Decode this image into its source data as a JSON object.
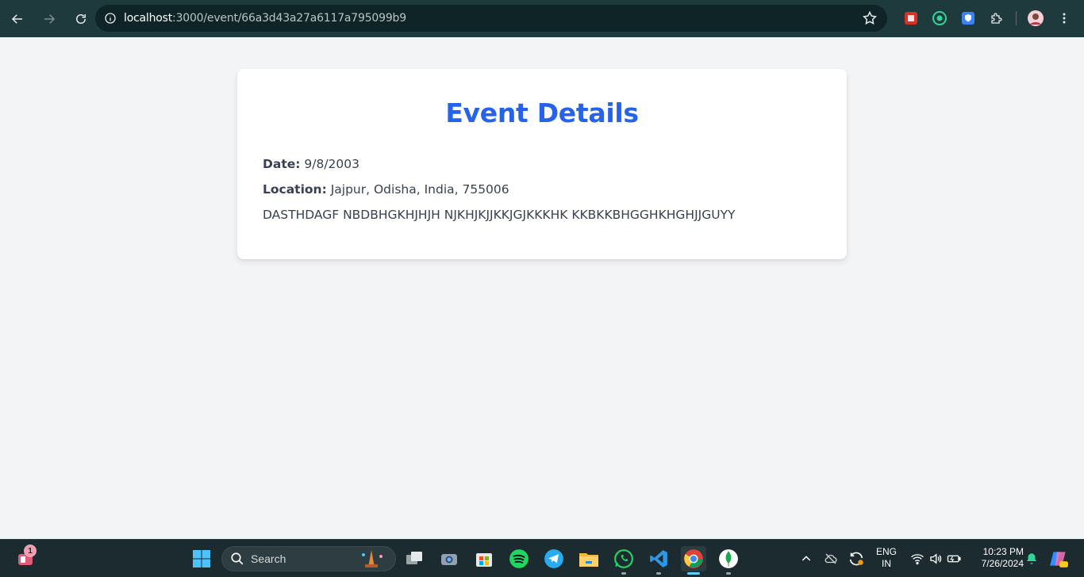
{
  "browser": {
    "url_host": "localhost",
    "url_path": ":3000/event/66a3d43a27a6117a795099b9",
    "back_icon": "arrow-left-icon",
    "forward_icon": "arrow-right-icon",
    "reload_icon": "reload-icon",
    "bookmark_icon": "star-icon",
    "extensions": [
      "extension-red-icon",
      "extension-target-icon",
      "extension-shield-icon",
      "puzzle-icon"
    ],
    "profile_icon": "avatar-icon",
    "menu_icon": "kebab-menu-icon"
  },
  "event": {
    "title": "Event Details",
    "date_label": "Date:",
    "date_value": "9/8/2003",
    "location_label": "Location:",
    "location_value": "Jajpur, Odisha, India, 755006",
    "description": "DASTHDAGF NBDBHGKHJHJH NJKHJKJJKKJGJKKKHK KKBKKBHGGHKHGHJJGUYY"
  },
  "taskbar": {
    "widget_badge": "1",
    "search_label": "Search",
    "apps": [
      "windows-start-icon",
      "task-view-icon",
      "camera-icon",
      "microsoft-store-icon",
      "spotify-icon",
      "telegram-icon",
      "file-explorer-icon",
      "whatsapp-icon",
      "vscode-icon",
      "chrome-icon",
      "mongodb-icon"
    ],
    "tray": {
      "lang_top": "ENG",
      "lang_bottom": "IN",
      "time": "10:23 PM",
      "date": "7/26/2024"
    }
  },
  "colors": {
    "title_blue": "#2563eb",
    "page_bg": "#f3f4f6",
    "chrome_bar": "#1f3a3d",
    "taskbar": "#1c2b2f"
  }
}
